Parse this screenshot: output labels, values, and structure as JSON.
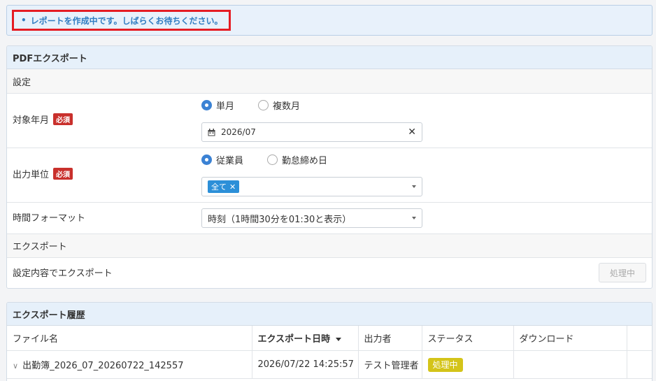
{
  "notice": {
    "bullet": "•",
    "text": "レポートを作成中です。しばらくお待ちください。"
  },
  "pdf_export": {
    "title": "PDFエクスポート",
    "settings_section": "設定",
    "target_month": {
      "label": "対象年月",
      "required": "必須",
      "options": [
        "単月",
        "複数月"
      ],
      "selected": "単月",
      "date_value": "2026/07"
    },
    "output_unit": {
      "label": "出力単位",
      "required": "必須",
      "options": [
        "従業員",
        "勤怠締め日"
      ],
      "selected": "従業員",
      "tag": "全て"
    },
    "time_format": {
      "label": "時間フォーマット",
      "value": "時刻（1時間30分を01:30と表示）"
    },
    "export_section": "エクスポート",
    "export_row": {
      "label": "設定内容でエクスポート",
      "button": "処理中"
    }
  },
  "history": {
    "title": "エクスポート履歴",
    "columns": [
      "ファイル名",
      "エクスポート日時",
      "出力者",
      "ステータス",
      "ダウンロード"
    ],
    "rows": [
      {
        "file": "出勤簿_2026_07_20260722_142557",
        "datetime": "2026/07/22 14:25:57",
        "user": "テスト管理者",
        "status": "処理中",
        "download": ""
      }
    ]
  },
  "colors": {
    "accent": "#3b82d4",
    "required": "#c9302c",
    "status_processing": "#d4c419",
    "notice_text": "#2f7cc1",
    "highlight_border": "#e51c23"
  }
}
